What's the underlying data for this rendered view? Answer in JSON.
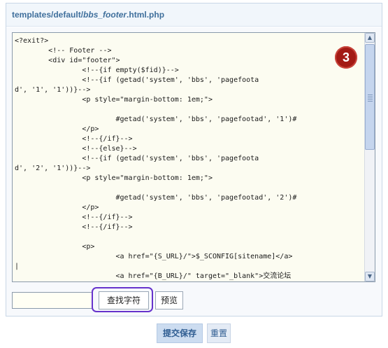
{
  "header": {
    "path_prefix": "templates/default/",
    "file_name": "bbs_footer",
    "file_ext": ".html.php"
  },
  "editor": {
    "badge_number": "3",
    "code": "<?exit?>\n\t<!-- Footer -->\n\t<div id=\"footer\">\n\t\t<!--{if empty($fid)}-->\n\t\t<!--{if (getad('system', 'bbs', 'pagefoota\nd', '1', '1'))}-->\n\t\t<p style=\"margin-bottom: 1em;\">\n\n\t\t\t#getad('system', 'bbs', 'pagefootad', '1')#\n\t\t</p>\n\t\t<!--{/if}-->\n\t\t<!--{else}-->\n\t\t<!--{if (getad('system', 'bbs', 'pagefoota\nd', '2', '1'))}-->\n\t\t<p style=\"margin-bottom: 1em;\">\n\n\t\t\t#getad('system', 'bbs', 'pagefootad', '2')#\n\t\t</p>\n\t\t<!--{/if}-->\n\t\t<!--{/if}-->\n\n\t\t<p>\n\t\t\t<a href=\"{S_URL}/\">$_SCONFIG[sitename]</a>\n|\n\t\t\t<a href=\"{B_URL}/\" target=\"_blank\">交流论坛"
  },
  "toolbar": {
    "search_value": "",
    "find_label": "查找字符",
    "preview_label": "预览"
  },
  "footer": {
    "submit_label": "提交保存",
    "reset_label": "重置"
  },
  "colors": {
    "header_text": "#3f6f9c",
    "editor_bg": "#fcfcf1",
    "badge": "#a31a14",
    "highlight": "#6633cc"
  }
}
